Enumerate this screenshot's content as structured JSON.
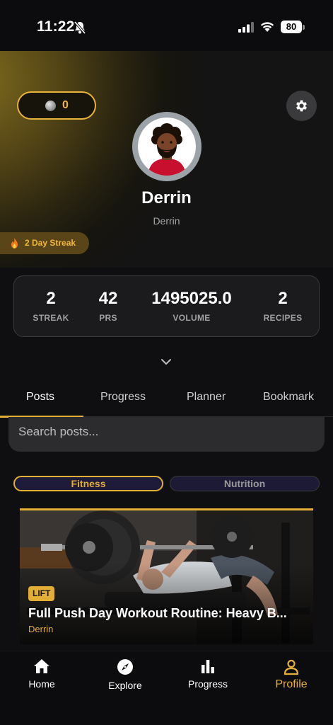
{
  "status_bar": {
    "time": "11:22",
    "battery": "80",
    "icons": [
      "bell-slash-icon",
      "signal-icon",
      "wifi-icon",
      "battery-icon"
    ]
  },
  "profile": {
    "coins": "0",
    "display_name": "Derrin",
    "username": "Derrin",
    "streak_badge": "2 Day Streak"
  },
  "stats": [
    {
      "value": "2",
      "label": "STREAK"
    },
    {
      "value": "42",
      "label": "PRS"
    },
    {
      "value": "1495025.0",
      "label": "VOLUME"
    },
    {
      "value": "2",
      "label": "RECIPES"
    }
  ],
  "tabs": [
    {
      "label": "Posts",
      "active": true
    },
    {
      "label": "Progress",
      "active": false
    },
    {
      "label": "Planner",
      "active": false
    },
    {
      "label": "Bookmark",
      "active": false
    }
  ],
  "search": {
    "placeholder": "Search posts..."
  },
  "filters": [
    {
      "label": "Fitness",
      "selected": true
    },
    {
      "label": "Nutrition",
      "selected": false
    }
  ],
  "post": {
    "tag": "LIFT",
    "title": "Full Push Day Workout Routine: Heavy B...",
    "author": "Derrin"
  },
  "bottom_nav": [
    {
      "label": "Home",
      "icon": "home-icon",
      "active": false
    },
    {
      "label": "Explore",
      "icon": "compass-icon",
      "active": false
    },
    {
      "label": "Progress",
      "icon": "bar-chart-icon",
      "active": false
    },
    {
      "label": "Profile",
      "icon": "user-icon",
      "active": true
    }
  ],
  "colors": {
    "accent": "#e2ae35",
    "background": "#0f0f11",
    "card": "#1b1b1d"
  }
}
